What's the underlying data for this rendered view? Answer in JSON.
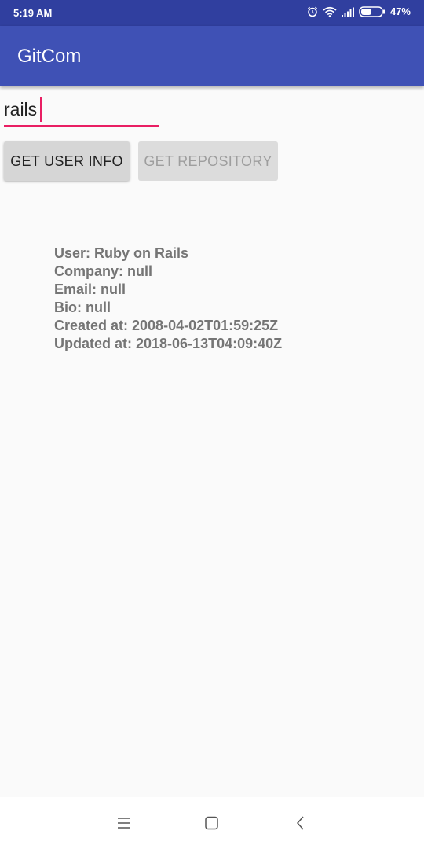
{
  "status_bar": {
    "time": "5:19 AM",
    "battery": "47%"
  },
  "app_bar": {
    "title": "GitCom"
  },
  "search": {
    "value": "rails"
  },
  "buttons": {
    "user_info": "GET USER INFO",
    "repository": "GET REPOSITORY"
  },
  "user_info": {
    "user": "User: Ruby on Rails",
    "company": "Company: null",
    "email": "Email: null",
    "bio": "Bio: null",
    "created": "Created at: 2008-04-02T01:59:25Z",
    "updated": "Updated at: 2018-06-13T04:09:40Z"
  },
  "colors": {
    "primary_dark": "#303f9f",
    "primary": "#3f51b5",
    "accent": "#e91e63"
  },
  "icons": {
    "status": [
      "alarm-icon",
      "wifi-icon",
      "signal-icon",
      "battery-icon"
    ],
    "nav": [
      "menu-icon",
      "home-icon",
      "back-icon"
    ]
  }
}
